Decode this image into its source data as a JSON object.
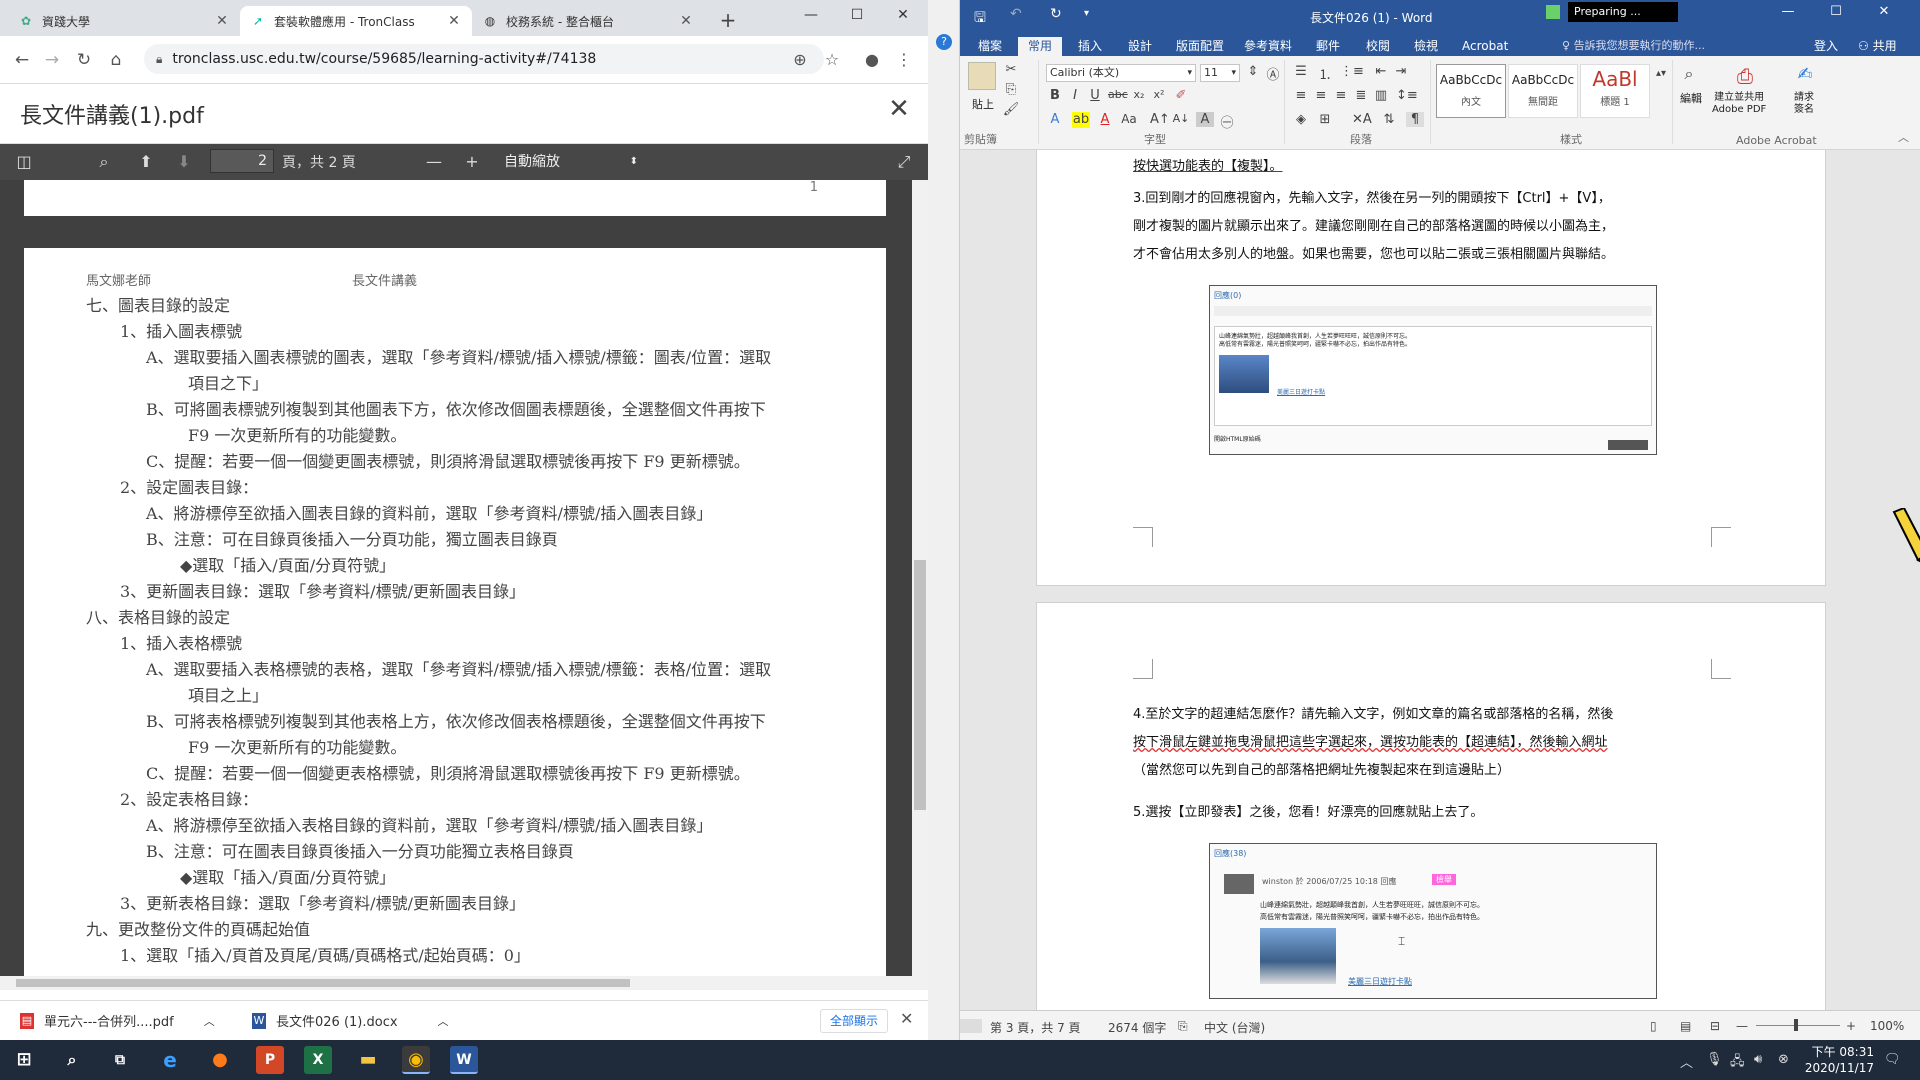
{
  "chrome": {
    "tabs": [
      {
        "title": "資踐大學",
        "active": false
      },
      {
        "title": "套裝軟體應用 - TronClass",
        "active": true
      },
      {
        "title": "校務系統 - 整合櫃台",
        "active": false
      }
    ],
    "url": "tronclass.usc.edu.tw/course/59685/learning-activity#/74138"
  },
  "pdf": {
    "title": "長文件講義(1).pdf",
    "page_current": "2",
    "page_of": "頁，共 2 頁",
    "zoom": "自動縮放",
    "prev_page_number": "1",
    "header_left": "馬文娜老師",
    "header_right": "長文件講義",
    "lines": [
      "七、圖表目錄的設定",
      "1、插入圖表標號",
      "A、選取要插入圖表標號的圖表，選取「參考資料/標號/插入標號/標籤：圖表/位置：選取",
      "項目之下」",
      "B、可將圖表標號列複製到其他圖表下方，依次修改個圖表標題後，全選整個文件再按下",
      "F9 一次更新所有的功能變數。",
      "C、提醒：若要一個一個變更圖表標號，則須將滑鼠選取標號後再按下 F9 更新標號。",
      "2、設定圖表目錄：",
      "A、將游標停至欲插入圖表目錄的資料前，選取「參考資料/標號/插入圖表目錄」",
      "B、注意：可在目錄頁後插入一分頁功能，獨立圖表目錄頁",
      "◆選取「插入/頁面/分頁符號」",
      "3、更新圖表目錄：選取「參考資料/標號/更新圖表目錄」",
      "八、表格目錄的設定",
      "1、插入表格標號",
      "A、選取要插入表格標號的表格，選取「參考資料/標號/插入標號/標籤：表格/位置：選取",
      "項目之上」",
      "B、可將表格標號列複製到其他表格上方，依次修改個表格標題後，全選整個文件再按下",
      "F9 一次更新所有的功能變數。",
      "C、提醒：若要一個一個變更表格標號，則須將滑鼠選取標號後再按下 F9 更新標號。",
      "2、設定表格目錄：",
      "A、將游標停至欲插入表格目錄的資料前，選取「參考資料/標號/插入圖表目錄」",
      "B、注意：可在圖表目錄頁後插入一分頁功能獨立表格目錄頁",
      "◆選取「插入/頁面/分頁符號」",
      "3、更新表格目錄：選取「參考資料/標號/更新圖表目錄」",
      "九、更改整份文件的頁碼起始值",
      "1、選取「插入/頁首及頁尾/頁碼/頁碼格式/起始頁碼：0」"
    ]
  },
  "downloads": {
    "items": [
      "單元六---合併列....pdf",
      "長文件026 (1).docx"
    ],
    "show_all": "全部顯示"
  },
  "word": {
    "title": "長文件026 (1) - Word",
    "preparing": "Preparing ...",
    "tabs": [
      "檔案",
      "常用",
      "插入",
      "設計",
      "版面配置",
      "參考資料",
      "郵件",
      "校閱",
      "檢視",
      "Acrobat"
    ],
    "tell_me": "告訴我您想要執行的動作...",
    "sign_in": "登入",
    "share": "共用",
    "font_name": "Calibri (本文)",
    "font_size": "11",
    "styles": [
      {
        "preview": "AaBbCcDc",
        "name": "內文"
      },
      {
        "preview": "AaBbCcDc",
        "name": "無間距"
      },
      {
        "preview": "AaBl",
        "name": "標題 1"
      }
    ],
    "group_labels": [
      "剪貼簿",
      "字型",
      "段落",
      "樣式",
      "Adobe Acrobat"
    ],
    "paste_label": "貼上",
    "edit_label": "編輯",
    "acrobat_create": [
      "建立並共用",
      "Adobe PDF"
    ],
    "acrobat_sign": [
      "請求",
      "簽名"
    ],
    "para_copy": "按快選功能表的【複製】。",
    "para3_lines": [
      "3.回到剛才的回應視窗內，先輸入文字，然後在另一列的開頭按下【Ctrl】+【V】，",
      "剛才複製的圖片就顯示出來了。建議您剛剛在自己的部落格選圖的時候以小圖為主，",
      "才不會佔用太多別人的地盤。如果也需要，您也可以貼二張或三張相關圖片與聯結。"
    ],
    "para4_lines": [
      "4.至於文字的超連結怎麼作？請先輸入文字，例如文章的篇名或部落格的名稱，然後",
      "按下滑鼠左鍵並拖曳滑鼠把這些字選起來，選按功能表的【超連結】，然後輸入網址",
      "（當然您可以先到自己的部落格把網址先複製起來在到這邊貼上）"
    ],
    "para5": "5.選按【立即發表】之後，您看！好漂亮的回應就貼上去了。",
    "shot1": {
      "title": "回應(0)",
      "text1": "山峰連綿氣勢壯，超越顛峰我首創，人生若夢旺旺旺，誠信原則不可忘。",
      "text2": "高低常有雲霧迷，陽光普照笑呵呵，疆緊卡嚇不必忘，拍出作品有特色。",
      "link": "美麗三日遊打卡點",
      "check": "開啟HTML原始碼"
    },
    "shot2": {
      "title": "回應(38)",
      "meta": "winston 於 2006/07/25 10:18 回應",
      "badge": "檢舉",
      "text1": "山峰連綿氣勢壯，超越顛峰我首創，人生若夢旺旺旺，誠信原則不可忘。",
      "text2": "高低常有雲霧迷，陽光普照笑呵呵，疆緊卡嚇不必忘，拍出作品有特色。",
      "link": "美麗三日遊打卡點"
    },
    "status": {
      "page": "第 3 頁，共 7 頁",
      "words": "2674 個字",
      "lang": "中文 (台灣)",
      "zoom": "100%"
    }
  },
  "taskbar": {
    "time": "下午 08:31",
    "date": "2020/11/17"
  }
}
